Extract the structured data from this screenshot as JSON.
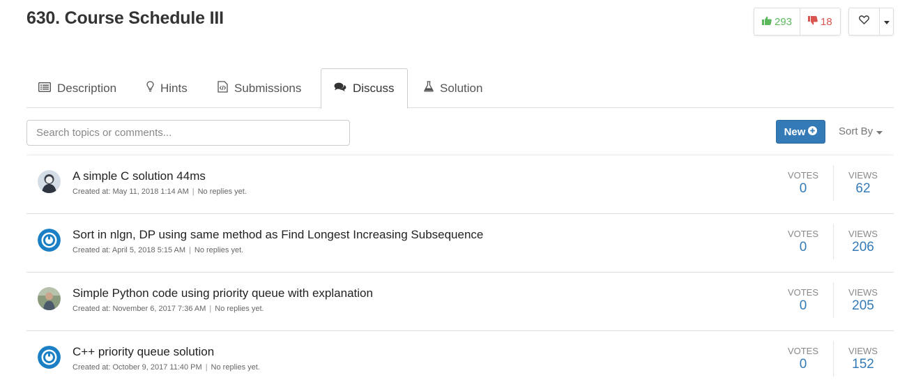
{
  "problem": {
    "title": "630. Course Schedule III"
  },
  "votes": {
    "likes": "293",
    "dislikes": "18"
  },
  "tabs": [
    {
      "label": "Description",
      "icon": "list-icon"
    },
    {
      "label": "Hints",
      "icon": "lightbulb-icon"
    },
    {
      "label": "Submissions",
      "icon": "code-file-icon"
    },
    {
      "label": "Discuss",
      "icon": "comments-icon"
    },
    {
      "label": "Solution",
      "icon": "flask-icon"
    }
  ],
  "active_tab": "Discuss",
  "search": {
    "placeholder": "Search topics or comments..."
  },
  "new_button": {
    "label": "New"
  },
  "sort": {
    "label": "Sort By"
  },
  "colors": {
    "accent": "#337ab7",
    "like": "#5cb85c",
    "dislike": "#d9534f"
  },
  "topics": [
    {
      "title": "A simple C solution 44ms",
      "created": "Created at: May 11, 2018 1:14 AM",
      "replies": "No replies yet.",
      "votes_label": "VOTES",
      "votes": "0",
      "views_label": "VIEWS",
      "views": "62",
      "avatar": "photo"
    },
    {
      "title": "Sort in nlgn, DP using same method as Find Longest Increasing Subsequence",
      "created": "Created at: April 5, 2018 5:15 AM",
      "replies": "No replies yet.",
      "votes_label": "VOTES",
      "votes": "0",
      "views_label": "VIEWS",
      "views": "206",
      "avatar": "default"
    },
    {
      "title": "Simple Python code using priority queue with explanation",
      "created": "Created at: November 6, 2017 7:36 AM",
      "replies": "No replies yet.",
      "votes_label": "VOTES",
      "votes": "0",
      "views_label": "VIEWS",
      "views": "205",
      "avatar": "photo"
    },
    {
      "title": "C++ priority queue solution",
      "created": "Created at: October 9, 2017 11:40 PM",
      "replies": "No replies yet.",
      "votes_label": "VOTES",
      "votes": "0",
      "views_label": "VIEWS",
      "views": "152",
      "avatar": "default"
    }
  ]
}
